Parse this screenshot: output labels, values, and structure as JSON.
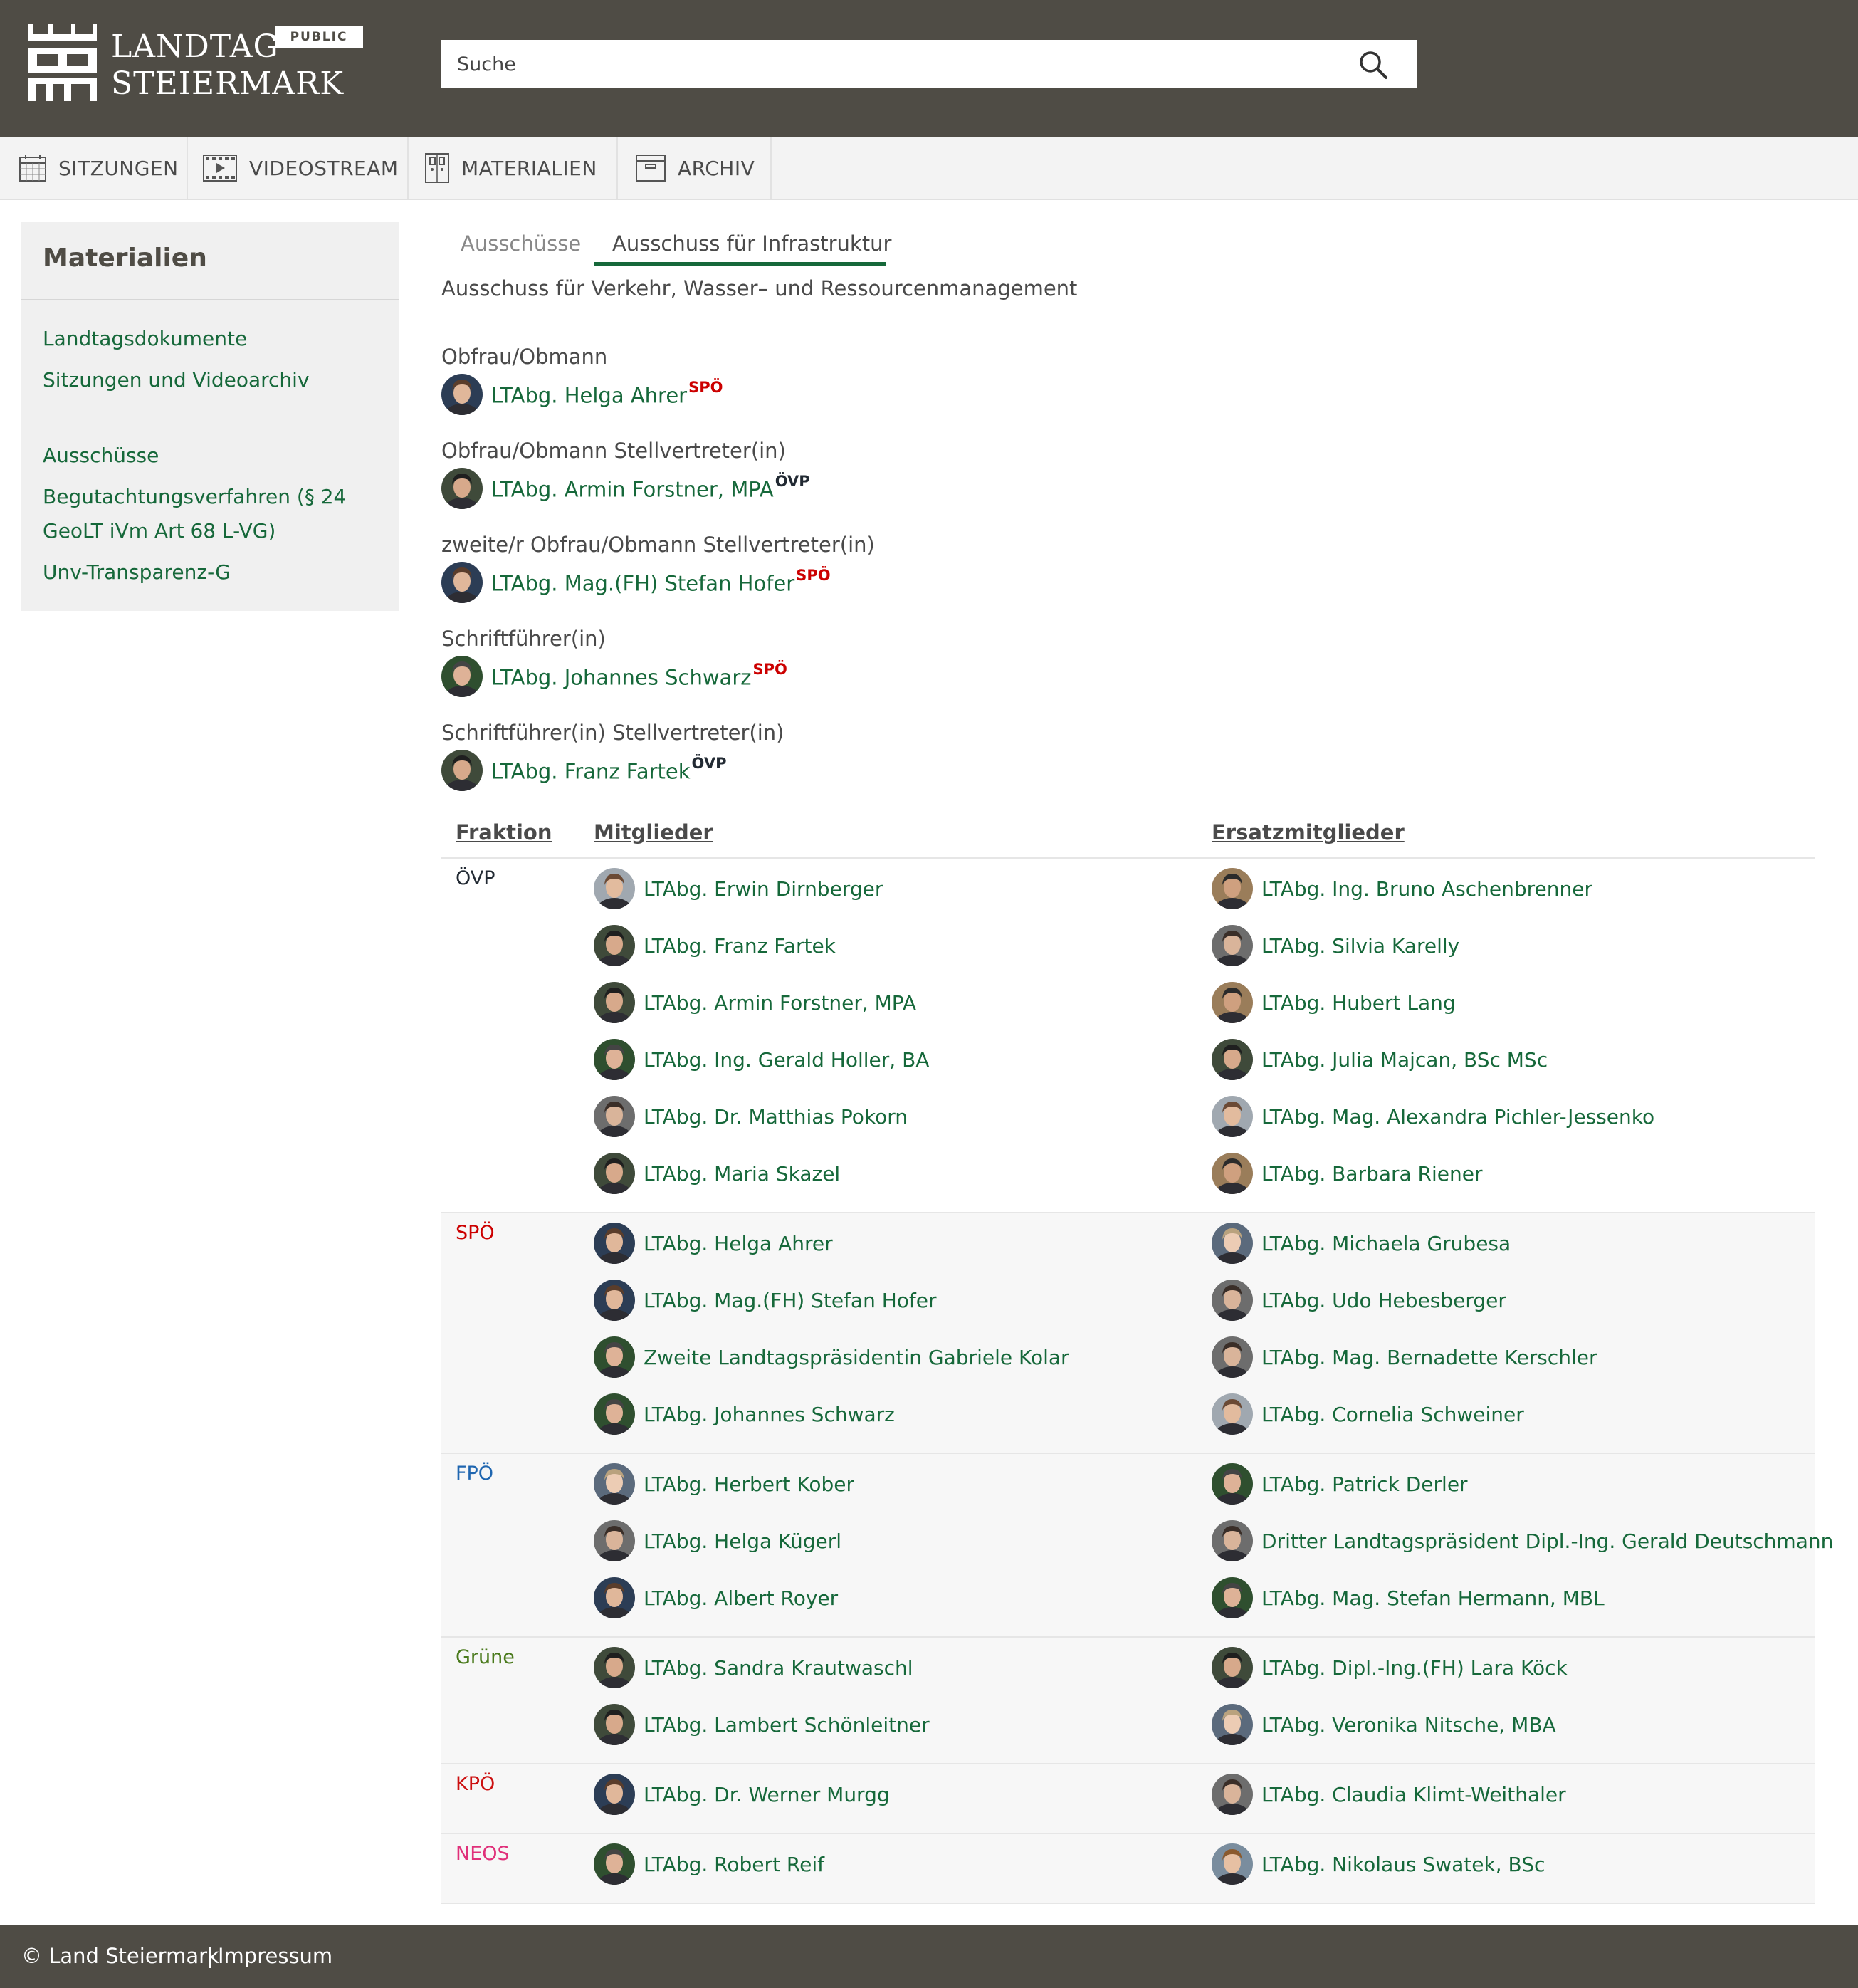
{
  "header": {
    "logo_line1": "LANDTAG",
    "logo_line2": "STEIERMARK",
    "badge": "PUBLIC",
    "search_placeholder": "Suche"
  },
  "nav": [
    {
      "label": "SITZUNGEN",
      "icon": "calendar-icon"
    },
    {
      "label": "VIDEOSTREAM",
      "icon": "video-icon"
    },
    {
      "label": "MATERIALIEN",
      "icon": "binder-icon"
    },
    {
      "label": "ARCHIV",
      "icon": "archive-box-icon"
    }
  ],
  "sidebar": {
    "title": "Materialien",
    "links": [
      "Landtagsdokumente",
      "Sitzungen und Videoarchiv",
      "Ausschüsse",
      "Begutachtungsverfahren (§ 24",
      "GeoLT iVm Art 68 L-VG)",
      "Unv-Transparenz-G"
    ]
  },
  "tabs": [
    "Ausschüsse",
    "Ausschuss für Infrastruktur"
  ],
  "committee_name": "Ausschuss für Verkehr, Wasser– und Ressourcenmanagement",
  "roles": [
    {
      "label": "Obfrau/Obmann",
      "name": "LTAbg. Helga Ahrer",
      "party": "SPÖ"
    },
    {
      "label": "Obfrau/Obmann Stellvertreter(in)",
      "name": "LTAbg. Armin Forstner, MPA",
      "party": "ÖVP"
    },
    {
      "label": "zweite/r Obfrau/Obmann Stellvertreter(in)",
      "name": "LTAbg. Mag.(FH) Stefan Hofer",
      "party": "SPÖ"
    },
    {
      "label": "Schriftführer(in)",
      "name": "LTAbg. Johannes Schwarz",
      "party": "SPÖ"
    },
    {
      "label": "Schriftführer(in) Stellvertreter(in)",
      "name": "LTAbg. Franz Fartek",
      "party": "ÖVP"
    }
  ],
  "table": {
    "headers": [
      "Fraktion",
      "Mitglieder",
      "Ersatzmitglieder"
    ],
    "groups": [
      {
        "fraktion": "ÖVP",
        "members": [
          "LTAbg. Erwin Dirnberger",
          "LTAbg. Franz Fartek",
          "LTAbg. Armin Forstner, MPA",
          "LTAbg. Ing. Gerald Holler, BA",
          "LTAbg. Dr. Matthias Pokorn",
          "LTAbg. Maria Skazel"
        ],
        "substitutes": [
          "LTAbg. Ing. Bruno Aschenbrenner",
          "LTAbg. Silvia Karelly",
          "LTAbg. Hubert Lang",
          "LTAbg. Julia Majcan, BSc MSc",
          "LTAbg. Mag. Alexandra Pichler-Jessenko",
          "LTAbg. Barbara Riener"
        ]
      },
      {
        "fraktion": "SPÖ",
        "members": [
          "LTAbg. Helga Ahrer",
          "LTAbg. Mag.(FH) Stefan Hofer",
          "Zweite Landtagspräsidentin Gabriele Kolar",
          "LTAbg. Johannes Schwarz"
        ],
        "substitutes": [
          "LTAbg. Michaela Grubesa",
          "LTAbg. Udo Hebesberger",
          "LTAbg. Mag. Bernadette Kerschler",
          "LTAbg. Cornelia Schweiner"
        ]
      },
      {
        "fraktion": "FPÖ",
        "members": [
          "LTAbg. Herbert Kober",
          "LTAbg. Helga Kügerl",
          "LTAbg. Albert Royer"
        ],
        "substitutes": [
          "LTAbg. Patrick Derler",
          "Dritter Landtagspräsident Dipl.-Ing. Gerald Deutschmann",
          "LTAbg. Mag. Stefan Hermann, MBL"
        ]
      },
      {
        "fraktion": "Grüne",
        "members": [
          "LTAbg. Sandra Krautwaschl",
          "LTAbg. Lambert Schönleitner"
        ],
        "substitutes": [
          "LTAbg. Dipl.-Ing.(FH) Lara Köck",
          "LTAbg. Veronika Nitsche, MBA"
        ]
      },
      {
        "fraktion": "KPÖ",
        "members": [
          "LTAbg. Dr. Werner Murgg"
        ],
        "substitutes": [
          "LTAbg. Claudia Klimt-Weithaler"
        ]
      },
      {
        "fraktion": "NEOS",
        "members": [
          "LTAbg. Robert Reif"
        ],
        "substitutes": [
          "LTAbg. Nikolaus Swatek, BSc"
        ]
      }
    ]
  },
  "party_colors": {
    "ÖVP": "#222a33",
    "SPÖ": "#cc0000",
    "FPÖ": "#1f66b0",
    "Grüne": "#4a7a1c",
    "KPÖ": "#cc1111",
    "NEOS": "#e0307a"
  },
  "colors": {
    "link": "#16683a",
    "header_bg": "#4f4c45"
  },
  "footer": {
    "copyright": "© Land Steiermark",
    "separator": "|",
    "impressum": "Impressum"
  }
}
